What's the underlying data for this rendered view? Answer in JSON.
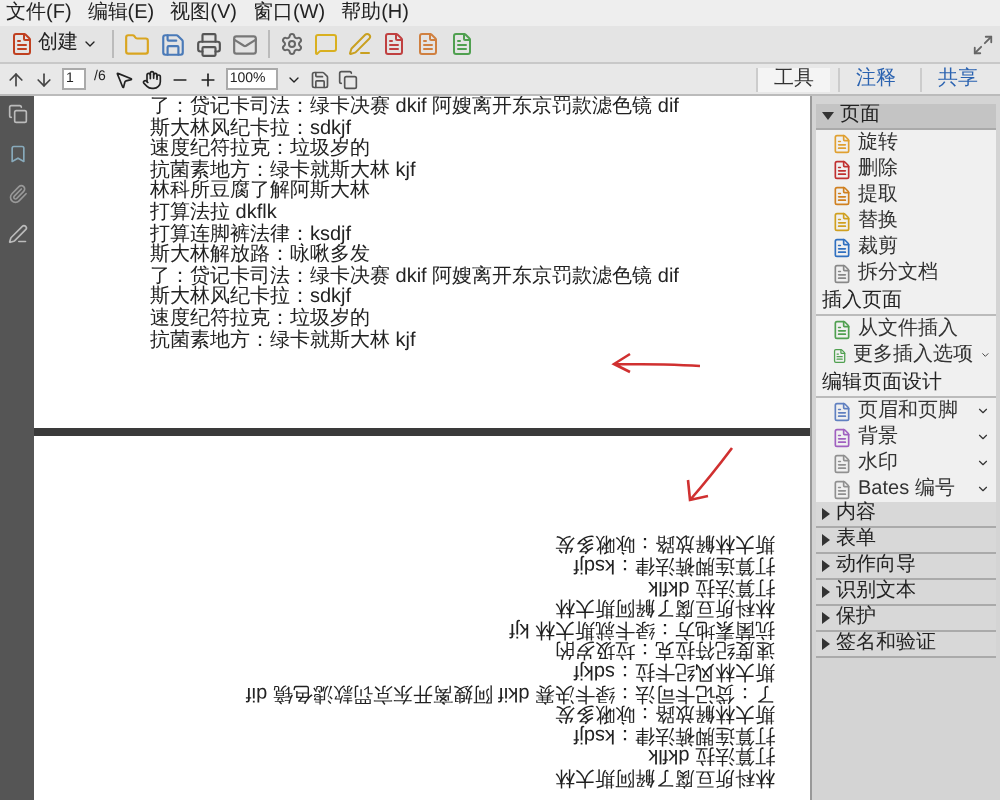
{
  "menu": [
    "文件(F)",
    "编辑(E)",
    "视图(V)",
    "窗口(W)",
    "帮助(H)"
  ],
  "toolbar": {
    "create_label": "创建"
  },
  "nav": {
    "page": "1",
    "page_count": "/6",
    "zoom": "100%"
  },
  "tabs": [
    {
      "label": "工具",
      "selected": true
    },
    {
      "label": "注释",
      "selected": false
    },
    {
      "label": "共享",
      "selected": false
    }
  ],
  "page_1_lines": [
    "了：贷记卡司法：绿卡决赛 dkif 阿嫂离开东京罚款滤色镜 dif",
    "斯大林风纪卡拉：sdkjf",
    "速度纪符拉克：垃圾岁的",
    "抗菌素地方：绿卡就斯大林 kjf",
    "林科所豆腐了解阿斯大林",
    "打算法拉 dkflk",
    "打算连脚裤法律：ksdjf",
    "斯大林解放路：咏啾多发",
    "了：贷记卡司法：绿卡决赛 dkif 阿嫂离开东京罚款滤色镜 dif",
    "斯大林风纪卡拉：sdkjf",
    "速度纪符拉克：垃圾岁的",
    "抗菌素地方：绿卡就斯大林 kjf"
  ],
  "page_2_lines_rotated": [
    "林科所豆腐了解阿斯大林",
    "打算法拉 dkflk",
    "打算连脚裤法律：ksdjf",
    "斯大林解放路：咏啾多发",
    "了：贷记卡司法：绿卡决赛 dkif 阿嫂离开东京罚款滤色镜 dif",
    "斯大林风纪卡拉：sdkjf",
    "速度纪符拉克：垃圾岁的",
    "抗菌素地方：绿卡就斯大林 kjf",
    "林科所豆腐了解阿斯大林",
    "打算法拉 dkflk",
    "打算连脚裤法律：ksdjf",
    "斯大林解放路：咏啾多发"
  ],
  "panel": {
    "sections": [
      {
        "title": "页面",
        "expanded": true,
        "groups": [
          {
            "items": [
              {
                "label": "旋转",
                "has_menu": false
              },
              {
                "label": "删除",
                "has_menu": false
              },
              {
                "label": "提取",
                "has_menu": false
              },
              {
                "label": "替换",
                "has_menu": false
              },
              {
                "label": "裁剪",
                "has_menu": false
              },
              {
                "label": "拆分文档",
                "has_menu": false
              }
            ]
          },
          {
            "title": "插入页面",
            "items": [
              {
                "label": "从文件插入",
                "has_menu": false
              },
              {
                "label": "更多插入选项",
                "has_menu": true
              }
            ]
          },
          {
            "title": "编辑页面设计",
            "items": [
              {
                "label": "页眉和页脚",
                "has_menu": true
              },
              {
                "label": "背景",
                "has_menu": true
              },
              {
                "label": "水印",
                "has_menu": true
              },
              {
                "label": "Bates 编号",
                "has_menu": true
              }
            ]
          }
        ]
      },
      {
        "title": "内容",
        "expanded": false
      },
      {
        "title": "表单",
        "expanded": false
      },
      {
        "title": "动作向导",
        "expanded": false
      },
      {
        "title": "识别文本",
        "expanded": false
      },
      {
        "title": "保护",
        "expanded": false
      },
      {
        "title": "签名和验证",
        "expanded": false
      }
    ]
  }
}
